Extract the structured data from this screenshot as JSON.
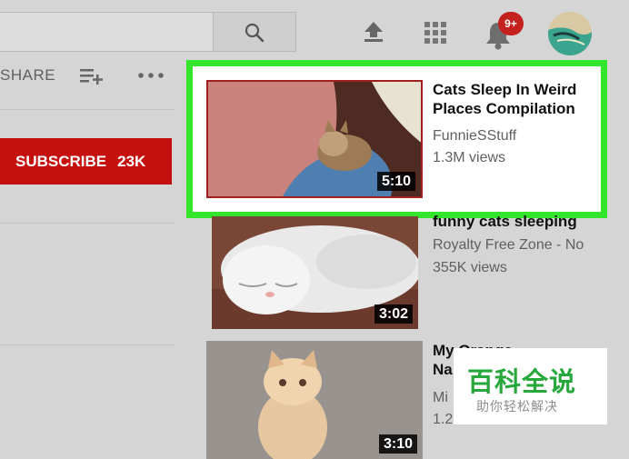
{
  "header": {
    "notifications_badge": "9+"
  },
  "actions": {
    "share_label": "SHARE",
    "subscribe_label": "SUBSCRIBE",
    "subscriber_count": "23K"
  },
  "videos": [
    {
      "title_line1": "Cats Sleep In Weird",
      "title_line2": "Places Compilation",
      "channel": "FunnieSStuff",
      "views": "1.3M views",
      "duration": "5:10"
    },
    {
      "title_line1": "funny cats sleeping",
      "channel": "Royalty Free Zone - No",
      "views": "355K views",
      "duration": "3:02"
    },
    {
      "title_line1": "My Orange",
      "title_line2": "Na",
      "channel": "Mi",
      "views": "1.2M views",
      "duration": "3:10"
    }
  ],
  "watermark": {
    "title": "百科全说",
    "subtitle": "助你轻松解决"
  },
  "colors": {
    "highlight": "#33e62b",
    "subscribe": "#c4110f",
    "badge": "#c4221f",
    "watermark_green": "#27a83c"
  }
}
